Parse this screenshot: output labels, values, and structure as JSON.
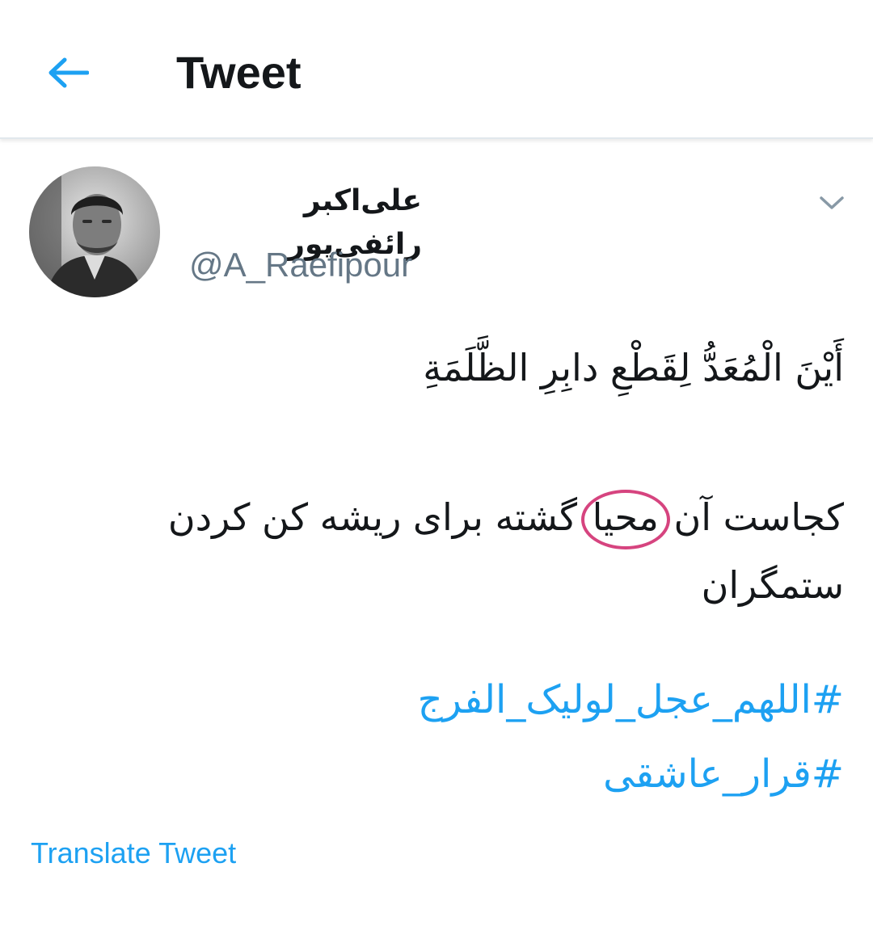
{
  "header": {
    "title": "Tweet",
    "back_icon": "arrow-left-icon"
  },
  "tweet": {
    "author": {
      "display_name": "علی‌اکبر رائفی‌پور",
      "handle": "@A_Raefipour"
    },
    "menu_icon": "chevron-down-icon",
    "text": {
      "arabic_line": "أَيْنَ الْمُعَدُّ لِقَطْعِ دابِرِ الظَّلَمَةِ",
      "persian_before": "کجاست آن ",
      "persian_highlight": "محیا",
      "persian_after": " گشته برای ریشه کن کردن ستمگران"
    },
    "hashtags": [
      "#اللهم_عجل_لولیک_الفرج",
      "#قرار_عاشقی"
    ],
    "translate_label": "Translate Tweet"
  },
  "colors": {
    "accent": "#1da1f2",
    "highlight_ring": "#d6447f",
    "secondary_text": "#657786",
    "primary_text": "#14171a"
  }
}
